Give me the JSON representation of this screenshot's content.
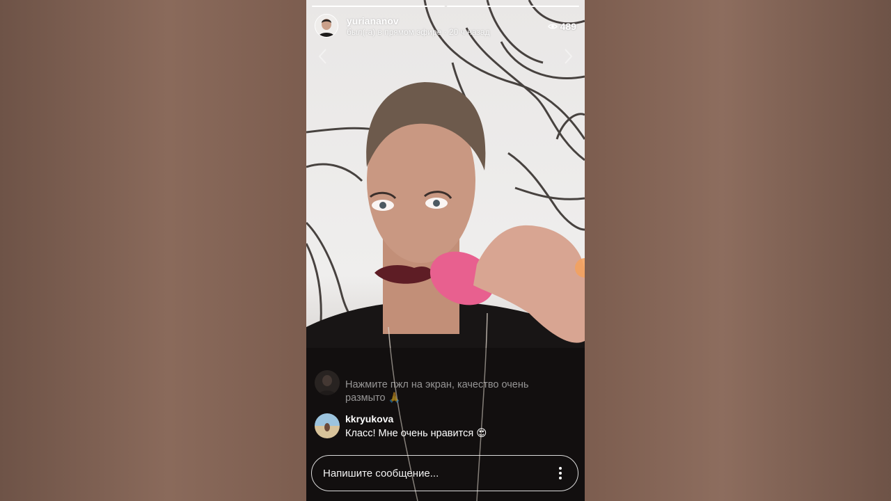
{
  "story": {
    "username": "yuriananov",
    "status": "был(-а) в прямом эфире · 20 ч назад",
    "viewer_count": "489"
  },
  "comments": [
    {
      "text": "Нажмите пжл на экран, качество очень размыто 🙏",
      "faded": true
    },
    {
      "username": "kkryukova",
      "text": "Класс! Мне очень нравится 😍",
      "faded": false
    }
  ],
  "composer": {
    "placeholder": "Напишите сообщение..."
  },
  "icons": [
    "eye-icon",
    "chevron-left-icon",
    "chevron-right-icon",
    "more-vertical-icon"
  ]
}
